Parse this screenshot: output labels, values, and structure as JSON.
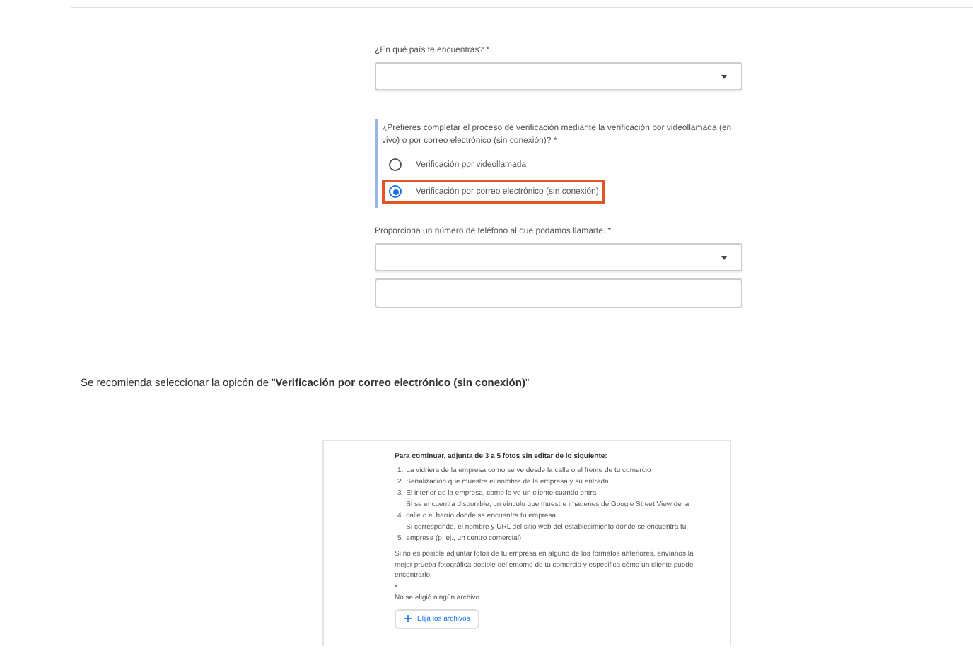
{
  "form": {
    "country": {
      "label": "¿En qué país te encuentras? *"
    },
    "verification": {
      "question": "¿Prefieres completar el proceso de verificación mediante la verificación por videollamada (en vivo) o por correo electrónico (sin conexión)? *",
      "options": [
        {
          "label": "Verificación por videollamada",
          "selected": false
        },
        {
          "label": "Verificación por correo electrónico (sin conexión)",
          "selected": true
        }
      ]
    },
    "phone": {
      "label": "Proporciona un número de teléfono al que podamos llamarte. *"
    }
  },
  "recommendation": "Se recomienda seleccionar la opicón de \"**Verificación por correo electrónico (sin conexión)**\"",
  "upload": {
    "heading": "Para continuar, adjunta de 3 a 5 fotos sin editar de lo siguiente:",
    "items": [
      {
        "number": "1.",
        "text": "La vidriera de la empresa como se ve desde la calle o el frente de tu comercio"
      },
      {
        "number": "2.",
        "text": "Señalización que muestre el nombre de la empresa y su entrada"
      },
      {
        "number": "3.",
        "text": "El interior de la empresa, como lo ve un cliente cuando entra"
      },
      {
        "number": "4.",
        "text": "Si se encuentra disponible, un vínculo que muestre imágenes de Google Street View de la calle o el barrio donde se encuentra tu empresa"
      },
      {
        "number": "5.",
        "text": "Si corresponde, el nombre y URL del sitio web del establecimiento donde se encuentra tu empresa (p. ej., un centro comercial)"
      }
    ],
    "note": "Si no es posible adjuntar fotos de tu empresa en alguno de los formatos anteriores, envíanos la mejor prueba fotográfica posible del entorno de tu comercio y especifica cómo un cliente puede encontrarlo.",
    "required_mark": "*",
    "no_file": "No se eligió ningún archivo",
    "button": "Elija los archivos"
  }
}
